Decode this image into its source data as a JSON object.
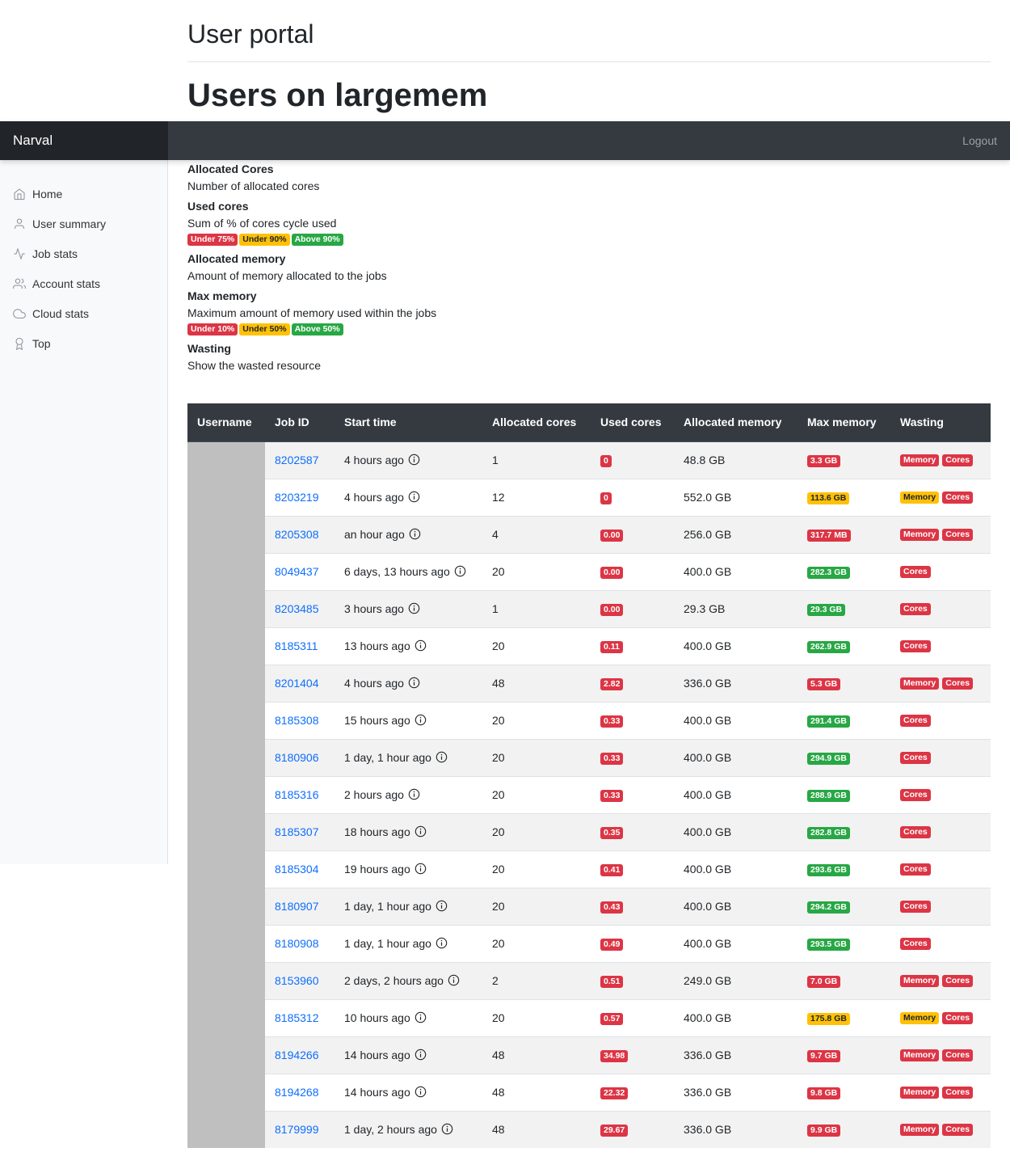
{
  "header": {
    "portal_title": "User portal",
    "page_title": "Users on largemem"
  },
  "navbar": {
    "brand": "Narval",
    "logout": "Logout"
  },
  "sidebar": {
    "items": [
      {
        "label": "Home",
        "icon": "home-icon"
      },
      {
        "label": "User summary",
        "icon": "user-icon"
      },
      {
        "label": "Job stats",
        "icon": "activity-icon"
      },
      {
        "label": "Account stats",
        "icon": "users-icon"
      },
      {
        "label": "Cloud stats",
        "icon": "cloud-icon"
      },
      {
        "label": "Top",
        "icon": "award-icon"
      }
    ]
  },
  "legend": {
    "allocated_cores": {
      "title": "Allocated Cores",
      "desc": "Number of allocated cores"
    },
    "used_cores": {
      "title": "Used cores",
      "desc": "Sum of % of cores cycle used",
      "badges": [
        {
          "text": "Under 75%",
          "color": "#dc3545"
        },
        {
          "text": "Under 90%",
          "color": "#ffc107"
        },
        {
          "text": "Above 90%",
          "color": "#28a745"
        }
      ]
    },
    "allocated_memory": {
      "title": "Allocated memory",
      "desc": "Amount of memory allocated to the jobs"
    },
    "max_memory": {
      "title": "Max memory",
      "desc": "Maximum amount of memory used within the jobs",
      "badges": [
        {
          "text": "Under 10%",
          "color": "#dc3545"
        },
        {
          "text": "Under 50%",
          "color": "#ffc107"
        },
        {
          "text": "Above 50%",
          "color": "#28a745"
        }
      ]
    },
    "wasting": {
      "title": "Wasting",
      "desc": "Show the wasted resource"
    }
  },
  "table": {
    "headers": [
      "Username",
      "Job ID",
      "Start time",
      "Allocated cores",
      "Used cores",
      "Allocated memory",
      "Max memory",
      "Wasting"
    ],
    "rows": [
      {
        "job": "8202587",
        "start": "4 hours ago",
        "alloc": "1",
        "used": "0",
        "used_color": "red",
        "amem": "48.8 GB",
        "maxmem": "3.3 GB",
        "max_color": "red",
        "waste": [
          [
            "Memory",
            "red"
          ],
          [
            "Cores",
            "red"
          ]
        ]
      },
      {
        "job": "8203219",
        "start": "4 hours ago",
        "alloc": "12",
        "used": "0",
        "used_color": "red",
        "amem": "552.0 GB",
        "maxmem": "113.6 GB",
        "max_color": "yellow",
        "waste": [
          [
            "Memory",
            "yellow"
          ],
          [
            "Cores",
            "red"
          ]
        ]
      },
      {
        "job": "8205308",
        "start": "an hour ago",
        "alloc": "4",
        "used": "0.00",
        "used_color": "red",
        "amem": "256.0 GB",
        "maxmem": "317.7 MB",
        "max_color": "red",
        "waste": [
          [
            "Memory",
            "red"
          ],
          [
            "Cores",
            "red"
          ]
        ]
      },
      {
        "job": "8049437",
        "start": "6 days, 13 hours ago",
        "alloc": "20",
        "used": "0.00",
        "used_color": "red",
        "amem": "400.0 GB",
        "maxmem": "282.3 GB",
        "max_color": "green",
        "waste": [
          [
            "Cores",
            "red"
          ]
        ]
      },
      {
        "job": "8203485",
        "start": "3 hours ago",
        "alloc": "1",
        "used": "0.00",
        "used_color": "red",
        "amem": "29.3 GB",
        "maxmem": "29.3 GB",
        "max_color": "green",
        "waste": [
          [
            "Cores",
            "red"
          ]
        ]
      },
      {
        "job": "8185311",
        "start": "13 hours ago",
        "alloc": "20",
        "used": "0.11",
        "used_color": "red",
        "amem": "400.0 GB",
        "maxmem": "262.9 GB",
        "max_color": "green",
        "waste": [
          [
            "Cores",
            "red"
          ]
        ]
      },
      {
        "job": "8201404",
        "start": "4 hours ago",
        "alloc": "48",
        "used": "2.82",
        "used_color": "red",
        "amem": "336.0 GB",
        "maxmem": "5.3 GB",
        "max_color": "red",
        "waste": [
          [
            "Memory",
            "red"
          ],
          [
            "Cores",
            "red"
          ]
        ]
      },
      {
        "job": "8185308",
        "start": "15 hours ago",
        "alloc": "20",
        "used": "0.33",
        "used_color": "red",
        "amem": "400.0 GB",
        "maxmem": "291.4 GB",
        "max_color": "green",
        "waste": [
          [
            "Cores",
            "red"
          ]
        ]
      },
      {
        "job": "8180906",
        "start": "1 day, 1 hour ago",
        "alloc": "20",
        "used": "0.33",
        "used_color": "red",
        "amem": "400.0 GB",
        "maxmem": "294.9 GB",
        "max_color": "green",
        "waste": [
          [
            "Cores",
            "red"
          ]
        ]
      },
      {
        "job": "8185316",
        "start": "2 hours ago",
        "alloc": "20",
        "used": "0.33",
        "used_color": "red",
        "amem": "400.0 GB",
        "maxmem": "288.9 GB",
        "max_color": "green",
        "waste": [
          [
            "Cores",
            "red"
          ]
        ]
      },
      {
        "job": "8185307",
        "start": "18 hours ago",
        "alloc": "20",
        "used": "0.35",
        "used_color": "red",
        "amem": "400.0 GB",
        "maxmem": "282.8 GB",
        "max_color": "green",
        "waste": [
          [
            "Cores",
            "red"
          ]
        ]
      },
      {
        "job": "8185304",
        "start": "19 hours ago",
        "alloc": "20",
        "used": "0.41",
        "used_color": "red",
        "amem": "400.0 GB",
        "maxmem": "293.6 GB",
        "max_color": "green",
        "waste": [
          [
            "Cores",
            "red"
          ]
        ]
      },
      {
        "job": "8180907",
        "start": "1 day, 1 hour ago",
        "alloc": "20",
        "used": "0.43",
        "used_color": "red",
        "amem": "400.0 GB",
        "maxmem": "294.2 GB",
        "max_color": "green",
        "waste": [
          [
            "Cores",
            "red"
          ]
        ]
      },
      {
        "job": "8180908",
        "start": "1 day, 1 hour ago",
        "alloc": "20",
        "used": "0.49",
        "used_color": "red",
        "amem": "400.0 GB",
        "maxmem": "293.5 GB",
        "max_color": "green",
        "waste": [
          [
            "Cores",
            "red"
          ]
        ]
      },
      {
        "job": "8153960",
        "start": "2 days, 2 hours ago",
        "alloc": "2",
        "used": "0.51",
        "used_color": "red",
        "amem": "249.0 GB",
        "maxmem": "7.0 GB",
        "max_color": "red",
        "waste": [
          [
            "Memory",
            "red"
          ],
          [
            "Cores",
            "red"
          ]
        ]
      },
      {
        "job": "8185312",
        "start": "10 hours ago",
        "alloc": "20",
        "used": "0.57",
        "used_color": "red",
        "amem": "400.0 GB",
        "maxmem": "175.8 GB",
        "max_color": "yellow",
        "waste": [
          [
            "Memory",
            "yellow"
          ],
          [
            "Cores",
            "red"
          ]
        ]
      },
      {
        "job": "8194266",
        "start": "14 hours ago",
        "alloc": "48",
        "used": "34.98",
        "used_color": "red",
        "amem": "336.0 GB",
        "maxmem": "9.7 GB",
        "max_color": "red",
        "waste": [
          [
            "Memory",
            "red"
          ],
          [
            "Cores",
            "red"
          ]
        ]
      },
      {
        "job": "8194268",
        "start": "14 hours ago",
        "alloc": "48",
        "used": "22.32",
        "used_color": "red",
        "amem": "336.0 GB",
        "maxmem": "9.8 GB",
        "max_color": "red",
        "waste": [
          [
            "Memory",
            "red"
          ],
          [
            "Cores",
            "red"
          ]
        ]
      },
      {
        "job": "8179999",
        "start": "1 day, 2 hours ago",
        "alloc": "48",
        "used": "29.67",
        "used_color": "red",
        "amem": "336.0 GB",
        "maxmem": "9.9 GB",
        "max_color": "red",
        "waste": [
          [
            "Memory",
            "red"
          ],
          [
            "Cores",
            "red"
          ]
        ]
      }
    ]
  }
}
